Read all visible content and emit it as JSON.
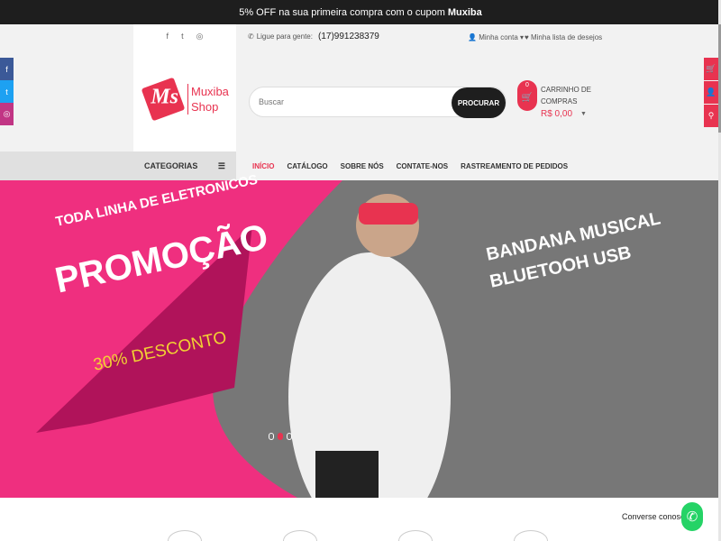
{
  "promo_bar": {
    "text": "5% OFF na sua primeira compra com o cupom",
    "coupon": "Muxiba"
  },
  "social_top": [
    "f",
    "t",
    "◎"
  ],
  "logo": {
    "mark": "Ms",
    "line1": "Muxiba",
    "line2": "Shop"
  },
  "contact": {
    "label": "Ligue para gente:",
    "phone": "(17)991238379"
  },
  "account": {
    "label": "Minha conta"
  },
  "wishlist": {
    "label": "Minha lista de desejos"
  },
  "search": {
    "placeholder": "Buscar",
    "button": "PROCURAR"
  },
  "cart": {
    "count": "0",
    "label": "CARRINHO DE COMPRAS",
    "total": "R$ 0,00"
  },
  "categories": {
    "label": "CATEGORIAS"
  },
  "nav": [
    "INÍCIO",
    "CATÁLOGO",
    "SOBRE NÓS",
    "CONTATE-NOS",
    "RASTREAMENTO DE PEDIDOS"
  ],
  "banner": {
    "left_line1": "TODA LINHA DE ELETRONICOS",
    "left_line2": "PROMOÇÃO",
    "left_line3": "30% DESCONTO",
    "right_line1": "BANDANA MUSICAL",
    "right_line2": "BLUETOOH USB"
  },
  "chat": {
    "label": "Converse conosco"
  },
  "colors": {
    "accent": "#e83350",
    "dark": "#1e1e1e",
    "facebook": "#3b5998",
    "twitter": "#1da1f2",
    "instagram": "#c13584"
  }
}
